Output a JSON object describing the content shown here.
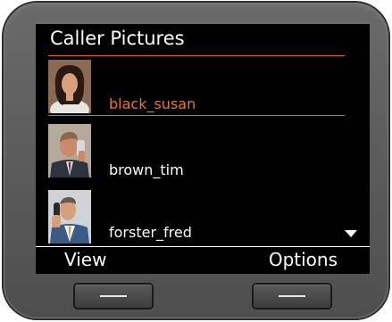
{
  "screen": {
    "title": "Caller Pictures",
    "accent_color": "#e06a20",
    "items": [
      {
        "name": "black_susan",
        "selected": true
      },
      {
        "name": "brown_tim",
        "selected": false
      },
      {
        "name": "forster_fred",
        "selected": false
      }
    ],
    "softkeys": {
      "left": "View",
      "right": "Options"
    }
  }
}
